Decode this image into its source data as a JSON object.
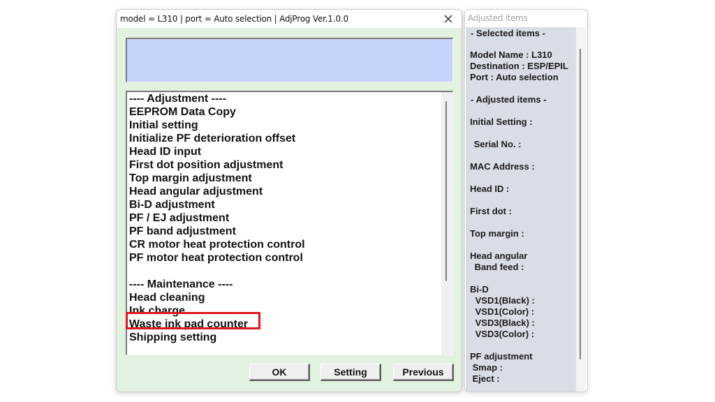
{
  "main_window": {
    "title": "model = L310 | port = Auto selection | AdjProg Ver.1.0.0",
    "close_icon": "close-icon",
    "status_text": "",
    "list_items": [
      {
        "label": "---- Adjustment ----",
        "type": "header"
      },
      {
        "label": "EEPROM Data Copy",
        "type": "item"
      },
      {
        "label": "Initial setting",
        "type": "item"
      },
      {
        "label": "Initialize PF deterioration offset",
        "type": "item"
      },
      {
        "label": "Head ID input",
        "type": "item"
      },
      {
        "label": "First dot position adjustment",
        "type": "item"
      },
      {
        "label": "Top margin adjustment",
        "type": "item"
      },
      {
        "label": "Head angular adjustment",
        "type": "item"
      },
      {
        "label": "Bi-D adjustment",
        "type": "item"
      },
      {
        "label": "PF / EJ adjustment",
        "type": "item"
      },
      {
        "label": "PF band adjustment",
        "type": "item"
      },
      {
        "label": "CR motor heat protection control",
        "type": "item"
      },
      {
        "label": "PF motor heat protection control",
        "type": "item"
      },
      {
        "label": "",
        "type": "blank"
      },
      {
        "label": "---- Maintenance ----",
        "type": "header"
      },
      {
        "label": "Head cleaning",
        "type": "item"
      },
      {
        "label": "Ink charge",
        "type": "item"
      },
      {
        "label": "Waste ink pad counter",
        "type": "item",
        "highlighted": true
      },
      {
        "label": "Shipping setting",
        "type": "item"
      }
    ],
    "highlight_color": "#e0161c",
    "buttons": {
      "ok": "OK",
      "setting": "Setting",
      "previous": "Previous"
    },
    "colors": {
      "dialog_bg": "#e2f2e0",
      "status_box_bg": "#c7d2fa"
    }
  },
  "side_panel": {
    "title": "Adjusted items",
    "lines": [
      {
        "text": "- Selected items -"
      },
      {
        "text": "Model Name : L310"
      },
      {
        "text": "Destination : ESP/EPIL"
      },
      {
        "text": "Port : Auto selection"
      },
      {
        "text": "- Adjusted items -"
      },
      {
        "text": "Initial Setting :"
      },
      {
        "text": " Serial No. :"
      },
      {
        "text": "MAC Address :"
      },
      {
        "text": "Head ID :"
      },
      {
        "text": "First dot :"
      },
      {
        "text": "Top margin :"
      },
      {
        "text": "Head angular"
      },
      {
        "text": " Band feed :"
      },
      {
        "text": "Bi-D"
      },
      {
        "text": " VSD1(Black) :"
      },
      {
        "text": " VSD1(Color) :"
      },
      {
        "text": " VSD3(Black) :"
      },
      {
        "text": " VSD3(Color) :"
      },
      {
        "text": "PF adjustment"
      },
      {
        "text": " Smap :"
      },
      {
        "text": " Eject :"
      }
    ],
    "colors": {
      "panel_bg": "#d9dde6"
    }
  }
}
